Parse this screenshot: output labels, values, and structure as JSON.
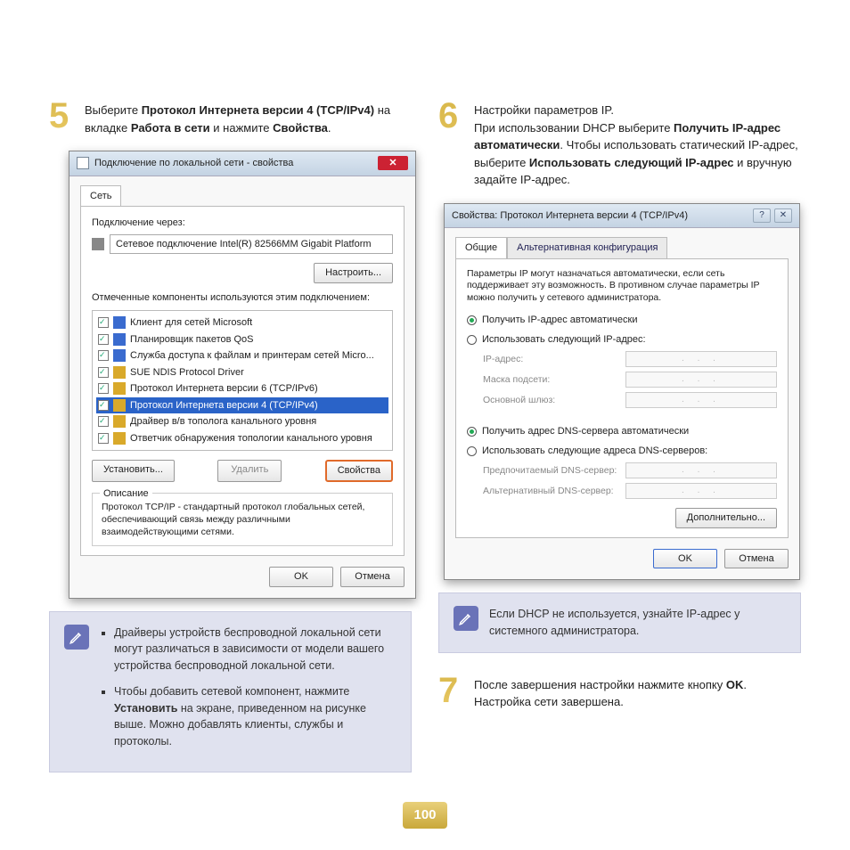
{
  "step5": {
    "num": "5",
    "text_1": "Выберите ",
    "bold_1": "Протокол Интернета версии 4 (TCP/IPv4)",
    "text_2": " на вкладке ",
    "bold_2": "Работа в сети",
    "text_3": " и нажмите ",
    "bold_3": "Свойства",
    "text_4": "."
  },
  "dlg1": {
    "title": "Подключение по локальной сети - свойства",
    "tab": "Сеть",
    "connect_through_label": "Подключение через:",
    "adapter": "Сетевое подключение Intel(R) 82566MM Gigabit Platform",
    "configure_btn": "Настроить...",
    "components_label": "Отмеченные компоненты используются этим подключением:",
    "items": [
      "Клиент для сетей Microsoft",
      "Планировщик пакетов QoS",
      "Служба доступа к файлам и принтерам сетей Micro...",
      "SUE NDIS Protocol Driver",
      "Протокол Интернета версии 6 (TCP/IPv6)",
      "Протокол Интернета версии 4 (TCP/IPv4)",
      "Драйвер в/в тополога канального уровня",
      "Ответчик обнаружения топологии канального уровня"
    ],
    "install_btn": "Установить...",
    "remove_btn": "Удалить",
    "props_btn": "Свойства",
    "desc_title": "Описание",
    "desc_text": "Протокол TCP/IP - стандартный протокол глобальных сетей, обеспечивающий связь между различными взаимодействующими сетями.",
    "ok": "OK",
    "cancel": "Отмена"
  },
  "note1": {
    "li1_a": "Драйверы устройств беспроводной локальной сети могут различаться в зависимости от модели вашего устройства беспроводной локальной сети.",
    "li2_a": "Чтобы добавить сетевой компонент, нажмите ",
    "li2_b": "Установить",
    "li2_c": " на экране, приведенном на рисунке выше. Можно добавлять клиенты, службы и протоколы."
  },
  "step6": {
    "num": "6",
    "line1": "Настройки параметров IP.",
    "text_1": "При использовании DHCP выберите ",
    "bold_1": "Получить IP-адрес автоматически",
    "text_2": ". Чтобы использовать статический IP-адрес, выберите ",
    "bold_2": "Использовать следующий IP-адрес",
    "text_3": " и вручную задайте IP-адрес."
  },
  "dlg2": {
    "title": "Свойства: Протокол Интернета версии 4 (TCP/IPv4)",
    "tab1": "Общие",
    "tab2": "Альтернативная конфигурация",
    "desc": "Параметры IP могут назначаться автоматически, если сеть поддерживает эту возможность. В противном случае параметры IP можно получить у сетевого администратора.",
    "radio_auto_ip": "Получить IP-адрес автоматически",
    "radio_man_ip": "Использовать следующий IP-адрес:",
    "ip_label": "IP-адрес:",
    "mask_label": "Маска подсети:",
    "gw_label": "Основной шлюз:",
    "radio_auto_dns": "Получить адрес DNS-сервера автоматически",
    "radio_man_dns": "Использовать следующие адреса DNS-серверов:",
    "dns1_label": "Предпочитаемый DNS-сервер:",
    "dns2_label": "Альтернативный DNS-сервер:",
    "adv_btn": "Дополнительно...",
    "ok": "OK",
    "cancel": "Отмена",
    "ip_placeholder": ". . ."
  },
  "note2": {
    "text": "Если DHCP не используется, узнайте IP-адрес у системного администратора."
  },
  "step7": {
    "num": "7",
    "text_1": "После завершения настройки нажмите кнопку ",
    "bold_1": "OK",
    "text_2": ". Настройка сети завершена."
  },
  "page_number": "100"
}
